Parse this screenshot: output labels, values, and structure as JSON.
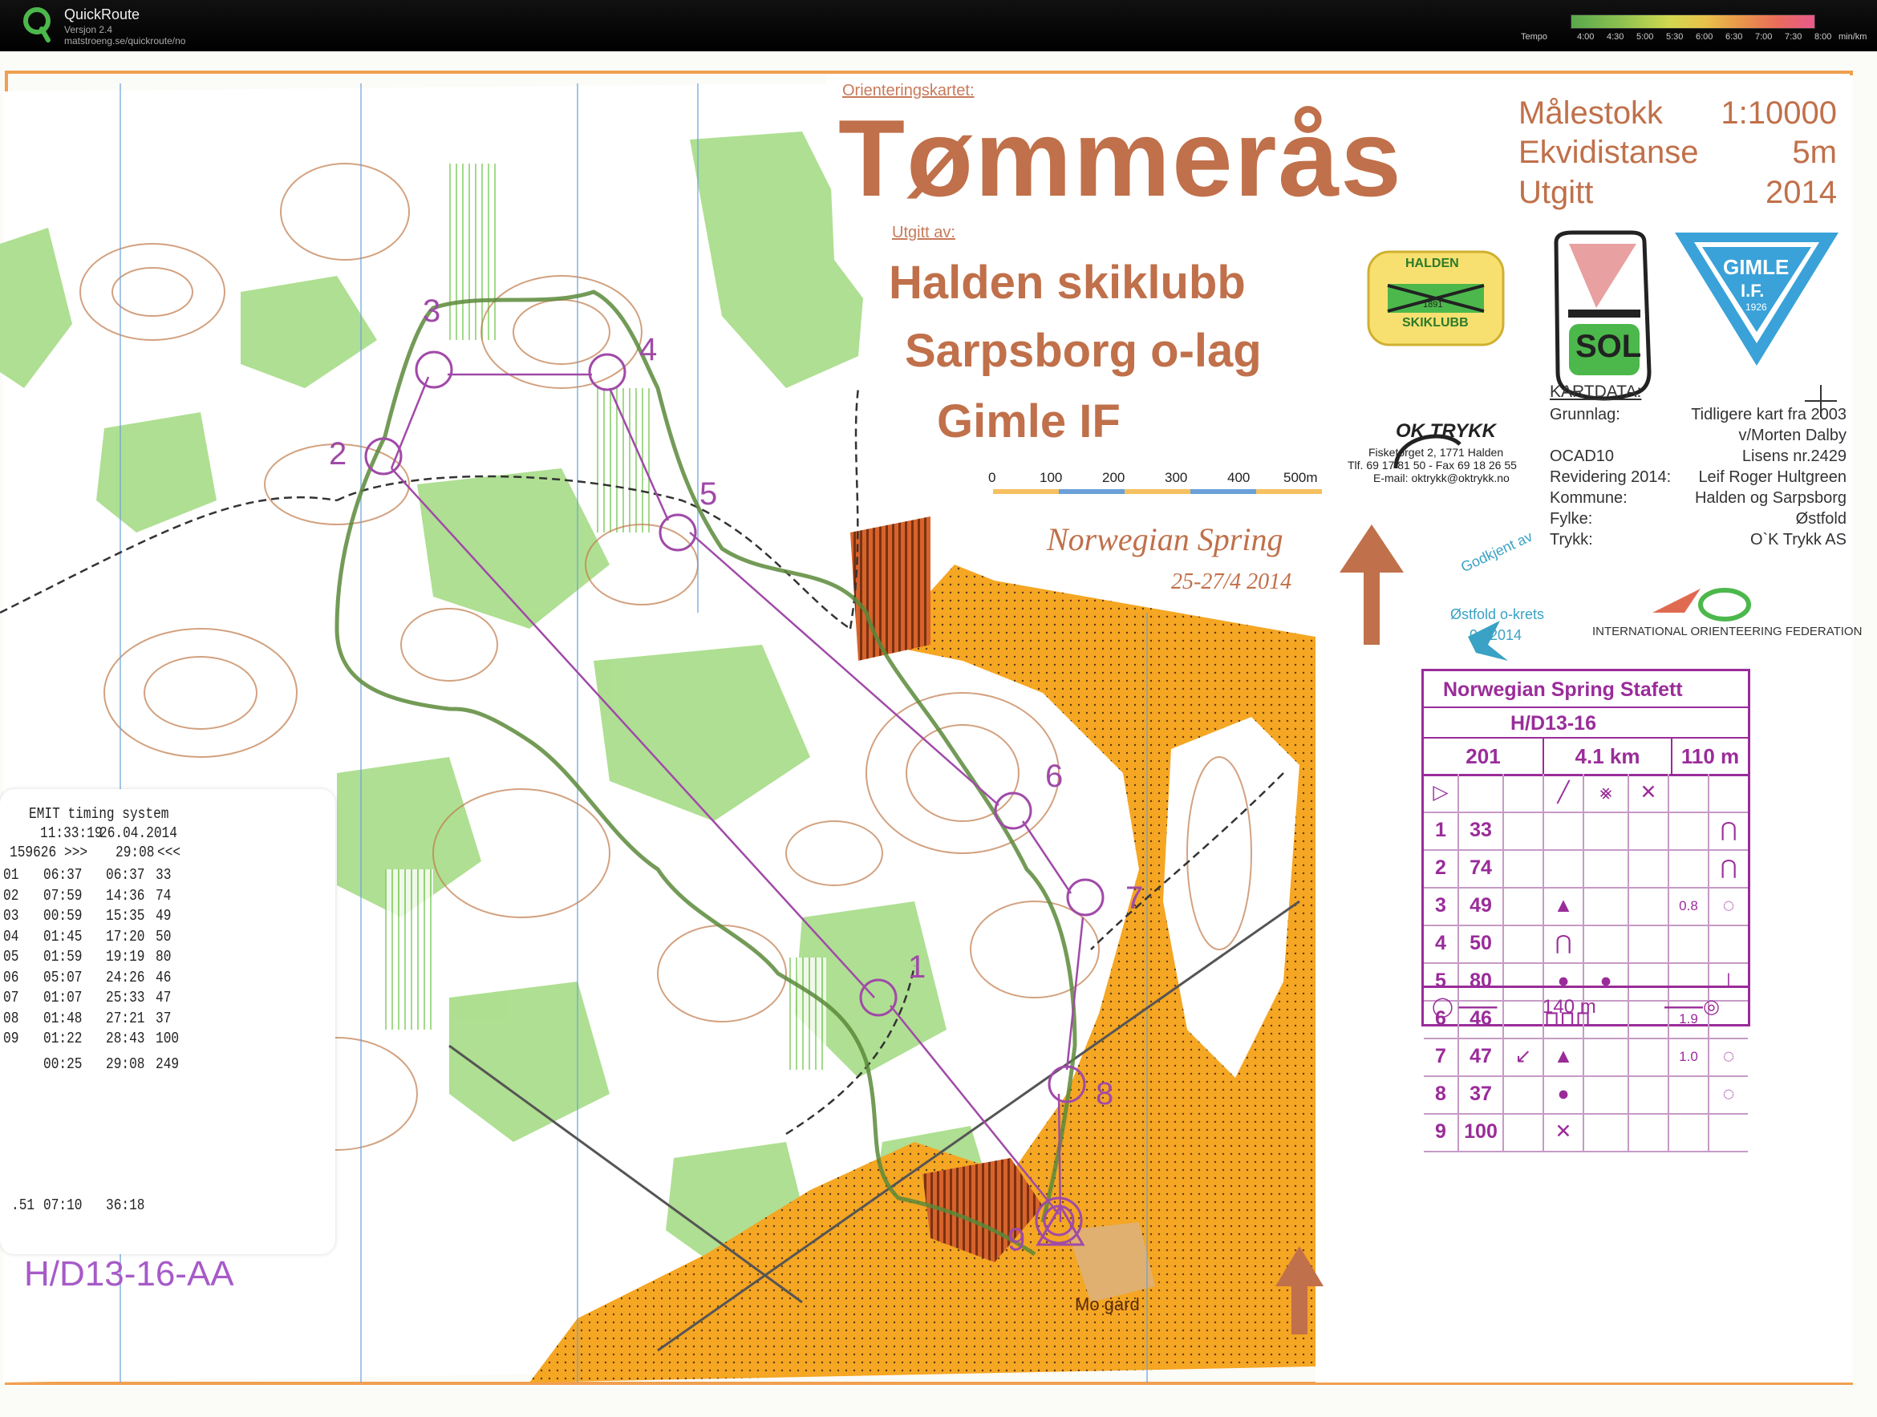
{
  "app": {
    "name": "QuickRoute",
    "version": "Versjon 2.4",
    "url": "matstroeng.se/quickroute/no",
    "tempo_label": "Tempo",
    "tempo_ticks": [
      "4:00",
      "4:30",
      "5:00",
      "5:30",
      "6:00",
      "6:30",
      "7:00",
      "7:30",
      "8:00",
      "min/km"
    ]
  },
  "map_header": {
    "pretitle": "Orienteringskartet:",
    "title": "Tømmerås",
    "publisher_label": "Utgitt av:",
    "clubs": [
      "Halden skiklubb",
      "Sarpsborg o-lag",
      "Gimle IF"
    ],
    "scale_label": "Målestokk",
    "scale_value": "1:10000",
    "contour_label": "Ekvidistanse",
    "contour_value": "5m",
    "published_label": "Utgitt",
    "published_value": "2014",
    "logo_halden_top": "HALDEN",
    "logo_halden_bottom": "SKIKLUBB",
    "logo_halden_year": "1891",
    "logo_sol": "SOL",
    "logo_gimle_top": "GIMLE",
    "logo_gimle_mid": "I.F.",
    "logo_gimle_year": "1926",
    "printer_name": "OK TRYKK",
    "printer_address": "Fisketorget 2,  1771  Halden",
    "printer_phone": "Tlf.  69 17 81 50  -  Fax  69 18 26 55",
    "printer_email": "E-mail: oktrykk@oktrykk.no",
    "scalebar_ticks": [
      "0",
      "100",
      "200",
      "300",
      "400",
      "500m"
    ],
    "event_name": "Norwegian Spring",
    "event_dates": "25-27/4 2014",
    "approved_label": "Godkjent av",
    "approved_by": "Østfold o-krets",
    "approved_date": "04/2014",
    "iof_text": "INTERNATIONAL  ORIENTEERING  FEDERATION"
  },
  "kartdata": {
    "heading": "KARTDATA:",
    "rows": [
      {
        "label": "Grunnlag:",
        "value": "Tidligere kart fra 2003"
      },
      {
        "label": "",
        "value": "v/Morten Dalby"
      },
      {
        "label": "OCAD10",
        "value": "Lisens nr.2429"
      },
      {
        "label": "Revidering 2014:",
        "value": "Leif Roger Hultgreen"
      },
      {
        "label": "Kommune:",
        "value": "Halden og Sarpsborg"
      },
      {
        "label": "Fylke:",
        "value": "Østfold"
      },
      {
        "label": "Trykk:",
        "value": "O`K Trykk AS"
      }
    ]
  },
  "control_description": {
    "title": "Norwegian Spring Stafett",
    "class": "H/D13-16",
    "course": "201",
    "length": "4.1 km",
    "climb": "110 m",
    "rows": [
      {
        "num": "1",
        "code": "33",
        "which": "",
        "feature": "",
        "appearance": "",
        "dim": "",
        "loc": "⋂"
      },
      {
        "num": "2",
        "code": "74",
        "which": "",
        "feature": "",
        "appearance": "",
        "dim": "",
        "loc": "⋂"
      },
      {
        "num": "3",
        "code": "49",
        "which": "",
        "feature": "▲",
        "appearance": "",
        "dim": "0.8",
        "loc": "◌"
      },
      {
        "num": "4",
        "code": "50",
        "which": "",
        "feature": "⋂",
        "appearance": "",
        "dim": "",
        "loc": ""
      },
      {
        "num": "5",
        "code": "80",
        "which": "",
        "feature": "●",
        "appearance": "●",
        "dim": "",
        "loc": "⊥"
      },
      {
        "num": "6",
        "code": "46",
        "which": "",
        "feature": "⊓⊓⊓",
        "appearance": "",
        "dim": "1.9",
        "loc": ""
      },
      {
        "num": "7",
        "code": "47",
        "which": "↙",
        "feature": "▲",
        "appearance": "",
        "dim": "1.0",
        "loc": "◌"
      },
      {
        "num": "8",
        "code": "37",
        "which": "",
        "feature": "●",
        "appearance": "",
        "dim": "",
        "loc": "◌"
      },
      {
        "num": "9",
        "code": "100",
        "which": "",
        "feature": "✕",
        "appearance": "",
        "dim": "",
        "loc": ""
      }
    ],
    "finish_distance": "140 m"
  },
  "timing_slip": {
    "header": "EMIT timing system",
    "time": "11:33:19",
    "date": "26.04.2014",
    "card": "159626",
    "card_sep": ">>>",
    "total": "29:08",
    "total_suffix": "<<<",
    "splits": [
      {
        "no": "01",
        "split": "06:37",
        "cum": "06:37",
        "code": "33"
      },
      {
        "no": "02",
        "split": "07:59",
        "cum": "14:36",
        "code": "74"
      },
      {
        "no": "03",
        "split": "00:59",
        "cum": "15:35",
        "code": "49"
      },
      {
        "no": "04",
        "split": "01:45",
        "cum": "17:20",
        "code": "50"
      },
      {
        "no": "05",
        "split": "01:59",
        "cum": "19:19",
        "code": "80"
      },
      {
        "no": "06",
        "split": "05:07",
        "cum": "24:26",
        "code": "46"
      },
      {
        "no": "07",
        "split": "01:07",
        "cum": "25:33",
        "code": "47"
      },
      {
        "no": "08",
        "split": "01:48",
        "cum": "27:21",
        "code": "37"
      },
      {
        "no": "09",
        "split": "01:22",
        "cum": "28:43",
        "code": "100"
      },
      {
        "no": "",
        "split": "00:25",
        "cum": "29:08",
        "code": "249"
      }
    ],
    "extra_no": ".51",
    "extra_split": "07:10",
    "extra_cum": "36:18"
  },
  "course_overlay": {
    "course_code": "H/D13-16-AA",
    "course_code_partial": "201",
    "controls": [
      "1",
      "2",
      "3",
      "4",
      "5",
      "6",
      "7",
      "8",
      "9"
    ],
    "finish_label": "Mo gard"
  },
  "colors": {
    "course": "#a04aa8",
    "map_text": "#c0704a",
    "open_land": "#f5a623",
    "forest_green": "#8ccf6e"
  }
}
